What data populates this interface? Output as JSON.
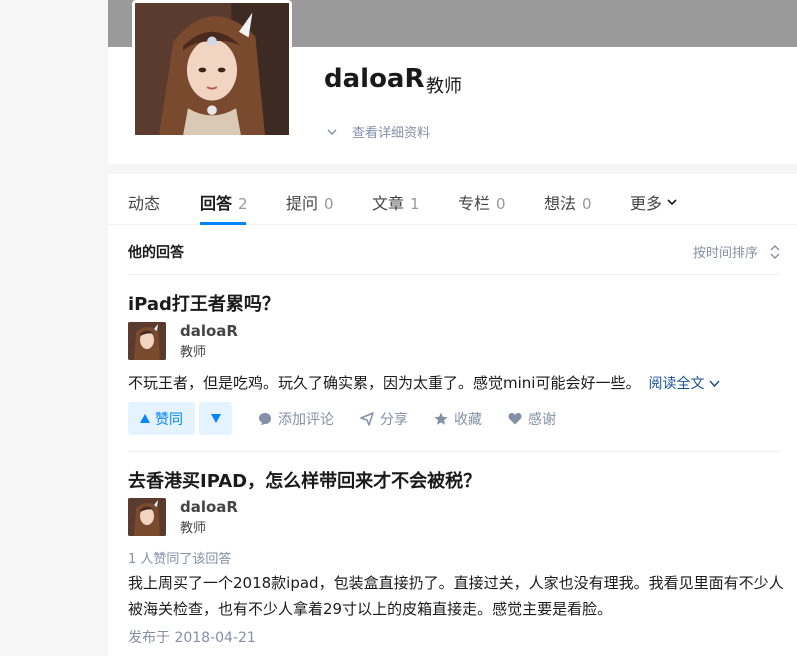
{
  "profile": {
    "name": "daloaR",
    "headline": "教师",
    "detail_link": "查看详细资料"
  },
  "tabs": [
    {
      "label": "动态",
      "count": ""
    },
    {
      "label": "回答",
      "count": "2"
    },
    {
      "label": "提问",
      "count": "0"
    },
    {
      "label": "文章",
      "count": "1"
    },
    {
      "label": "专栏",
      "count": "0"
    },
    {
      "label": "想法",
      "count": "0"
    },
    {
      "label": "更多",
      "count": ""
    }
  ],
  "section": {
    "title": "他的回答",
    "sort_label": "按时间排序"
  },
  "answers": [
    {
      "question": "iPad打王者累吗？",
      "author_name": "daloaR",
      "author_bio": "教师",
      "excerpt": "不玩王者，但是吃鸡。玩久了确实累，因为太重了。感觉mini可能会好一些。",
      "read_more": "阅读全文",
      "upvote_label": "赞同",
      "comment_label": "添加评论",
      "share_label": "分享",
      "collect_label": "收藏",
      "thanks_label": "感谢"
    },
    {
      "question": "去香港买IPAD，怎么样带回来才不会被税？",
      "author_name": "daloaR",
      "author_bio": "教师",
      "vote_count_text": "1 人赞同了该回答",
      "content_line1": "我上周买了一个2018款ipad，包装盒直接扔了。直接过关，人家也没有理我。我看见里面有不少人",
      "content_line2": "被海关检查，也有不少人拿着29寸以上的皮箱直接走。感觉主要是看脸。",
      "published": "发布于 2018-04-21"
    }
  ],
  "colors": {
    "accent": "#0084ff",
    "muted": "#8590a6",
    "link": "#175199"
  }
}
